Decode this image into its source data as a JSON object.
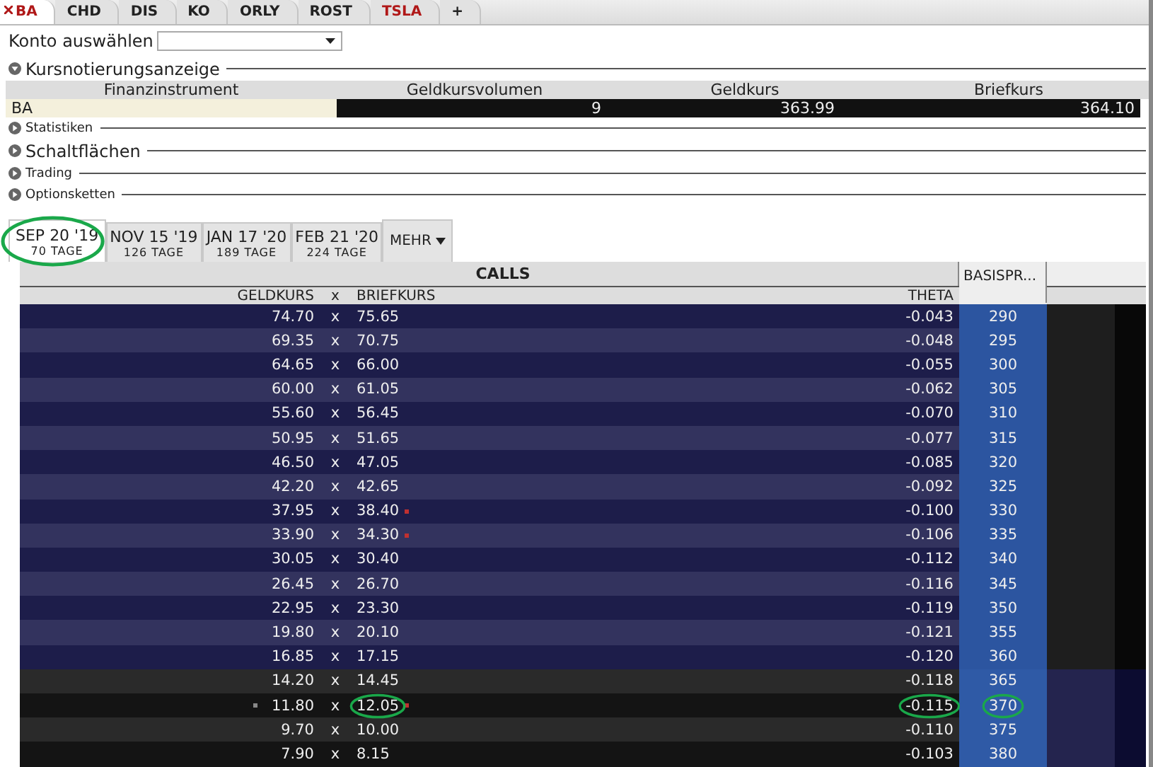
{
  "tabs": [
    {
      "label": "BA",
      "selected": true,
      "color": "#b01818"
    },
    {
      "label": "CHD",
      "selected": false,
      "color": "#222222"
    },
    {
      "label": "DIS",
      "selected": false,
      "color": "#222222"
    },
    {
      "label": "KO",
      "selected": false,
      "color": "#222222"
    },
    {
      "label": "ORLY",
      "selected": false,
      "color": "#222222"
    },
    {
      "label": "ROST",
      "selected": false,
      "color": "#222222"
    },
    {
      "label": "TSLA",
      "selected": false,
      "color": "#b01818"
    },
    {
      "label": "+",
      "selected": false,
      "color": "#222222"
    }
  ],
  "account": {
    "label": "Konto auswählen"
  },
  "quote_section": {
    "title": "Kursnotierungsanzeige",
    "expanded": true,
    "columns": [
      "Finanzinstrument",
      "Geldkursvolumen",
      "Geldkurs",
      "Briefkurs"
    ],
    "row": {
      "instrument": "BA",
      "bid_size": "9",
      "bid": "363.99",
      "ask": "364.10"
    }
  },
  "sections": [
    {
      "title": "Statistiken",
      "expanded": false,
      "kind": "minor"
    },
    {
      "title": "Schaltflächen",
      "expanded": false,
      "kind": "major"
    },
    {
      "title": "Trading",
      "expanded": false,
      "kind": "minor"
    },
    {
      "title": "Optionsketten",
      "expanded": false,
      "kind": "minor"
    }
  ],
  "expiries": [
    {
      "date": "SEP 20 '19",
      "days": "70 TAGE",
      "selected": true,
      "circled": true
    },
    {
      "date": "NOV 15 '19",
      "days": "126 TAGE",
      "selected": false,
      "circled": false
    },
    {
      "date": "JAN 17 '20",
      "days": "189 TAGE",
      "selected": false,
      "circled": false
    },
    {
      "date": "FEB 21 '20",
      "days": "224 TAGE",
      "selected": false,
      "circled": false
    }
  ],
  "more_button": "MEHR",
  "chain": {
    "calls_title": "CALLS",
    "columns": {
      "bid": "GELDKURS",
      "x": "x",
      "ask": "BRIEFKURS",
      "theta": "THETA",
      "strike": "BASISPR..."
    },
    "rows": [
      {
        "bid": "74.70",
        "x": "x",
        "ask": "75.65",
        "theta": "-0.043",
        "strike": "290",
        "in_the_money": true,
        "ask_flag": false,
        "bid_flag": false,
        "circled": false
      },
      {
        "bid": "69.35",
        "x": "x",
        "ask": "70.75",
        "theta": "-0.048",
        "strike": "295",
        "in_the_money": true,
        "ask_flag": false,
        "bid_flag": false,
        "circled": false
      },
      {
        "bid": "64.65",
        "x": "x",
        "ask": "66.00",
        "theta": "-0.055",
        "strike": "300",
        "in_the_money": true,
        "ask_flag": false,
        "bid_flag": false,
        "circled": false
      },
      {
        "bid": "60.00",
        "x": "x",
        "ask": "61.05",
        "theta": "-0.062",
        "strike": "305",
        "in_the_money": true,
        "ask_flag": false,
        "bid_flag": false,
        "circled": false
      },
      {
        "bid": "55.60",
        "x": "x",
        "ask": "56.45",
        "theta": "-0.070",
        "strike": "310",
        "in_the_money": true,
        "ask_flag": false,
        "bid_flag": false,
        "circled": false
      },
      {
        "bid": "50.95",
        "x": "x",
        "ask": "51.65",
        "theta": "-0.077",
        "strike": "315",
        "in_the_money": true,
        "ask_flag": false,
        "bid_flag": false,
        "circled": false
      },
      {
        "bid": "46.50",
        "x": "x",
        "ask": "47.05",
        "theta": "-0.085",
        "strike": "320",
        "in_the_money": true,
        "ask_flag": false,
        "bid_flag": false,
        "circled": false
      },
      {
        "bid": "42.20",
        "x": "x",
        "ask": "42.65",
        "theta": "-0.092",
        "strike": "325",
        "in_the_money": true,
        "ask_flag": false,
        "bid_flag": false,
        "circled": false
      },
      {
        "bid": "37.95",
        "x": "x",
        "ask": "38.40",
        "theta": "-0.100",
        "strike": "330",
        "in_the_money": true,
        "ask_flag": true,
        "bid_flag": false,
        "circled": false
      },
      {
        "bid": "33.90",
        "x": "x",
        "ask": "34.30",
        "theta": "-0.106",
        "strike": "335",
        "in_the_money": true,
        "ask_flag": true,
        "bid_flag": false,
        "circled": false
      },
      {
        "bid": "30.05",
        "x": "x",
        "ask": "30.40",
        "theta": "-0.112",
        "strike": "340",
        "in_the_money": true,
        "ask_flag": false,
        "bid_flag": false,
        "circled": false
      },
      {
        "bid": "26.45",
        "x": "x",
        "ask": "26.70",
        "theta": "-0.116",
        "strike": "345",
        "in_the_money": true,
        "ask_flag": false,
        "bid_flag": false,
        "circled": false
      },
      {
        "bid": "22.95",
        "x": "x",
        "ask": "23.30",
        "theta": "-0.119",
        "strike": "350",
        "in_the_money": true,
        "ask_flag": false,
        "bid_flag": false,
        "circled": false
      },
      {
        "bid": "19.80",
        "x": "x",
        "ask": "20.10",
        "theta": "-0.121",
        "strike": "355",
        "in_the_money": true,
        "ask_flag": false,
        "bid_flag": false,
        "circled": false
      },
      {
        "bid": "16.85",
        "x": "x",
        "ask": "17.15",
        "theta": "-0.120",
        "strike": "360",
        "in_the_money": true,
        "ask_flag": false,
        "bid_flag": false,
        "circled": false
      },
      {
        "bid": "14.20",
        "x": "x",
        "ask": "14.45",
        "theta": "-0.118",
        "strike": "365",
        "in_the_money": false,
        "ask_flag": false,
        "bid_flag": false,
        "circled": false
      },
      {
        "bid": "11.80",
        "x": "x",
        "ask": "12.05",
        "theta": "-0.115",
        "strike": "370",
        "in_the_money": false,
        "ask_flag": true,
        "bid_flag": true,
        "circled": true
      },
      {
        "bid": "9.70",
        "x": "x",
        "ask": "10.00",
        "theta": "-0.110",
        "strike": "375",
        "in_the_money": false,
        "ask_flag": false,
        "bid_flag": false,
        "circled": false
      },
      {
        "bid": "7.90",
        "x": "x",
        "ask": "8.15",
        "theta": "-0.103",
        "strike": "380",
        "in_the_money": false,
        "ask_flag": false,
        "bid_flag": false,
        "circled": false
      }
    ]
  }
}
